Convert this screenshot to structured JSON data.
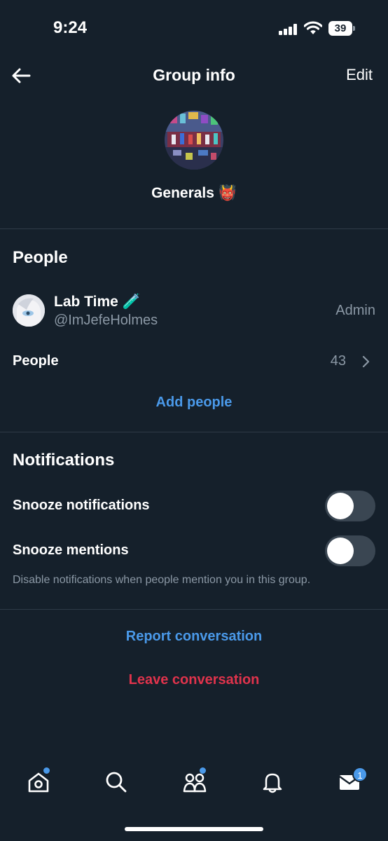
{
  "status_bar": {
    "time": "9:24",
    "battery": "39"
  },
  "header": {
    "title": "Group info",
    "edit_label": "Edit"
  },
  "group": {
    "name": "Generals 👹"
  },
  "people_section": {
    "title": "People",
    "member": {
      "name": "Lab Time 🧪",
      "handle": "@ImJefeHolmes",
      "role": "Admin"
    },
    "people_label": "People",
    "people_count": "43",
    "add_people_label": "Add people"
  },
  "notifications_section": {
    "title": "Notifications",
    "snooze_notifications_label": "Snooze notifications",
    "snooze_notifications_on": false,
    "snooze_mentions_label": "Snooze mentions",
    "snooze_mentions_on": false,
    "hint": "Disable notifications when people mention you in this group."
  },
  "actions": {
    "report_label": "Report conversation",
    "leave_label": "Leave conversation"
  },
  "tab_bar": {
    "items": [
      {
        "name": "home",
        "icon": "home-icon",
        "dot": true
      },
      {
        "name": "search",
        "icon": "search-icon",
        "dot": false
      },
      {
        "name": "communities",
        "icon": "communities-icon",
        "dot": true
      },
      {
        "name": "notifications",
        "icon": "bell-icon",
        "dot": false
      },
      {
        "name": "messages",
        "icon": "mail-icon",
        "badge": "1"
      }
    ]
  },
  "colors": {
    "background": "#15202b",
    "accent": "#4a99e9",
    "danger": "#e0334c",
    "muted": "#8b98a5"
  }
}
